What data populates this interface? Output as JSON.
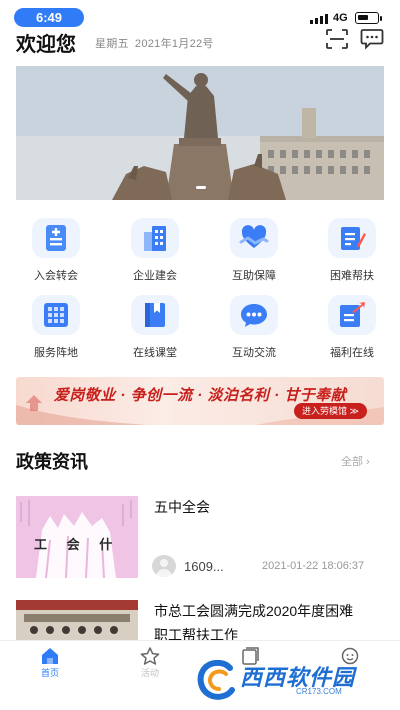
{
  "status_bar": {
    "time": "6:49",
    "network": "4G"
  },
  "header": {
    "welcome": "欢迎您",
    "weekday": "星期五",
    "date": "2021年1月22号",
    "scan_icon": "scan-icon",
    "message_icon": "message-icon"
  },
  "banner": {
    "active_slide": 1,
    "slide_count": 3
  },
  "grid": [
    {
      "label": "入会转会",
      "icon": "document-add-icon"
    },
    {
      "label": "企业建会",
      "icon": "building-icon"
    },
    {
      "label": "互助保障",
      "icon": "heart-hands-icon"
    },
    {
      "label": "困难帮扶",
      "icon": "edit-form-icon"
    },
    {
      "label": "服务阵地",
      "icon": "grid-apps-icon"
    },
    {
      "label": "在线课堂",
      "icon": "book-icon"
    },
    {
      "label": "互动交流",
      "icon": "chat-bubble-icon"
    },
    {
      "label": "福利在线",
      "icon": "share-icon"
    }
  ],
  "slogan": {
    "text": "爱岗敬业 · 争创一流 · 淡泊名利 · 甘于奉献",
    "button": "进入劳模馆 ≫"
  },
  "news_section": {
    "title": "政策资讯",
    "more": "全部 ›"
  },
  "news": [
    {
      "title": "五中全会",
      "author": "1609...",
      "time": "2021-01-22 18:06:37",
      "thumb_text": "工 会 什"
    },
    {
      "title_line1": "市总工会圆满完成2020年度困难",
      "title_line2": "职工帮扶工作"
    }
  ],
  "tabbar": [
    {
      "label": "首页",
      "icon": "home-icon",
      "active": true
    },
    {
      "label": "活动",
      "icon": "star-icon",
      "active": false
    },
    {
      "label": "",
      "icon": "news-icon",
      "active": false
    },
    {
      "label": "",
      "icon": "profile-icon",
      "active": false
    }
  ],
  "watermark": {
    "text": "西西软件园",
    "url": "CR173.COM"
  },
  "colors": {
    "accent": "#2f7cf6",
    "slogan_red": "#c8201c"
  }
}
